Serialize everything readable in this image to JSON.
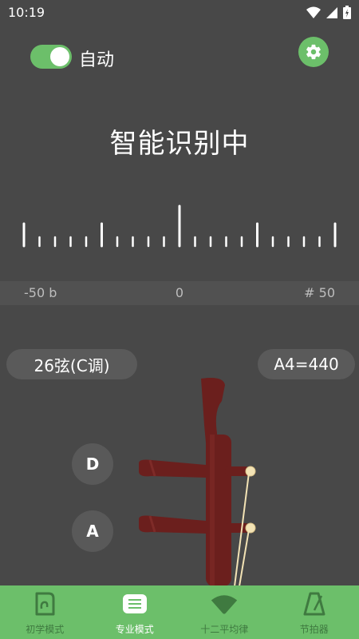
{
  "status_bar": {
    "time": "10:19",
    "icons": [
      "wifi-icon",
      "signal-icon",
      "battery-icon"
    ]
  },
  "header": {
    "auto_label": "自动",
    "auto_on": true,
    "settings_icon": "gear-icon"
  },
  "tuner": {
    "status_text": "智能识别中",
    "scale": {
      "left": "-50 b",
      "center": "0",
      "right": "# 50"
    }
  },
  "controls": {
    "key_label": "26弦(C调)",
    "reference_label": "A4=440"
  },
  "strings": [
    {
      "label": "D"
    },
    {
      "label": "A"
    }
  ],
  "bottom_nav": {
    "items": [
      {
        "label": "初学模式",
        "icon": "beginner-icon",
        "active": false
      },
      {
        "label": "专业模式",
        "icon": "pro-icon",
        "active": true
      },
      {
        "label": "十二平均律",
        "icon": "fan-icon",
        "active": false
      },
      {
        "label": "节拍器",
        "icon": "metronome-icon",
        "active": false
      }
    ]
  },
  "colors": {
    "accent": "#6cbf6a",
    "background": "#484848",
    "wood": "#6b1f1d"
  }
}
